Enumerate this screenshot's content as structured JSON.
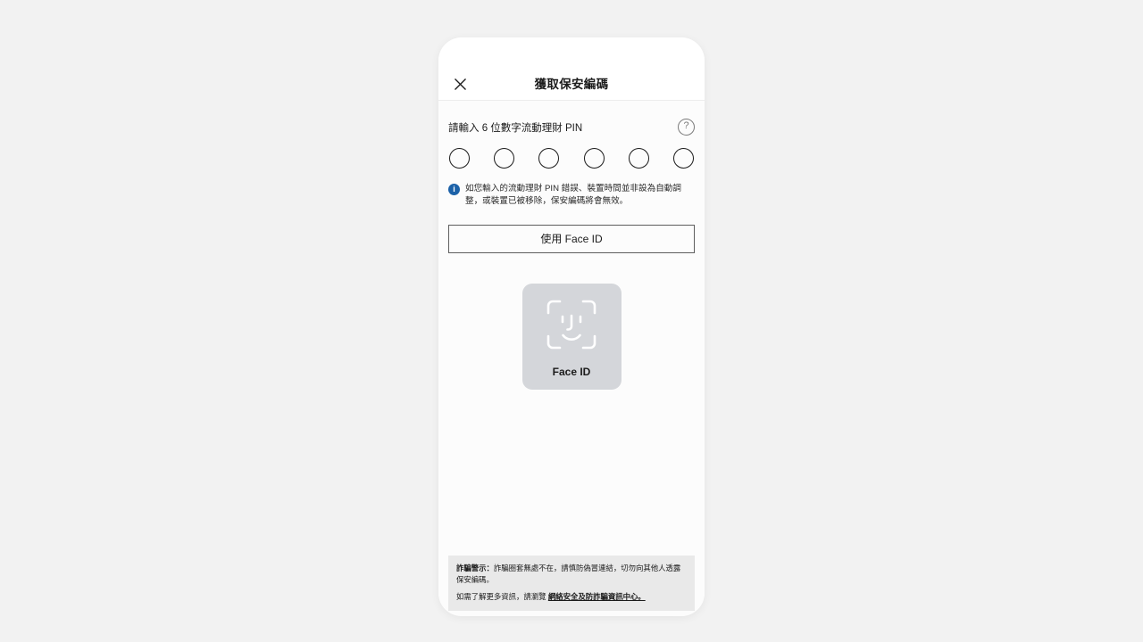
{
  "app": {
    "header": {
      "title": "獲取保安編碼",
      "close_icon": "close-icon"
    }
  },
  "pin_section": {
    "label": "請輸入 6 位數字流動理財 PIN",
    "help_icon": "help-circle-icon",
    "help_glyph": "?",
    "digits": 6,
    "values": [
      "",
      "",
      "",
      "",
      "",
      ""
    ],
    "note_icon": "info-icon",
    "note_glyph": "i",
    "note_text": "如您輸入的流動理財 PIN 錯誤、裝置時間並非設為自動調整，或裝置已被移除，保安編碼將會無效。"
  },
  "actions": {
    "use_faceid_label": "使用 Face ID"
  },
  "faceid_card": {
    "icon": "face-id-icon",
    "label": "Face ID"
  },
  "footer": {
    "warn_prefix": "詐騙警示：",
    "warn_body": "詐騙圈套無處不在，請慎防偽冒連結，切勿向其他人透露保安編碼。",
    "more_info_prefix": "如需了解更多資訊，請瀏覽 ",
    "link_text": "網絡安全及防詐騙資訊中心。"
  },
  "colors": {
    "page_background": "#f2f2f2",
    "phone_background": "#ffffff",
    "content_background": "#fcfcfc",
    "info_blue": "#1b61a8",
    "faceid_card": "#d4d6da",
    "footer_background": "#e9e9e9",
    "text_primary": "#1b1b1b"
  }
}
